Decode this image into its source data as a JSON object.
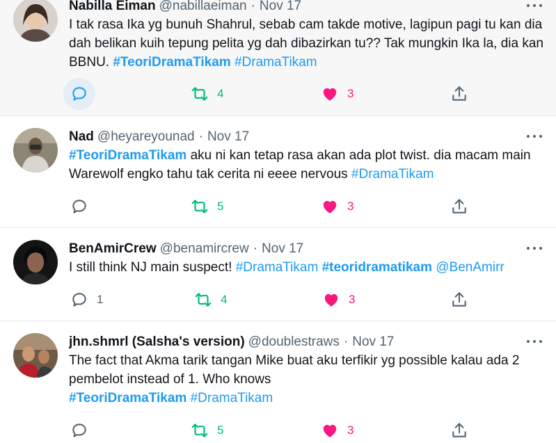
{
  "tweets": [
    {
      "name": "Nabilla Eiman",
      "handle": "@nabillaeiman",
      "sep": "·",
      "date": "Nov 17",
      "text": "I tak rasa Ika yg bunuh Shahrul, sebab cam takde motive, lagipun pagi tu kan dia dah belikan kuih tepung pelita yg dah dibazirkan tu?? Tak mungkin Ika la, dia kan BBNU. ",
      "tags": [
        "#TeoriDramaTikam",
        " ",
        "#DramaTikam"
      ],
      "replies": "",
      "retweets": "4",
      "likes": "3"
    },
    {
      "name": "Nad",
      "handle": "@heyareyounad",
      "sep": "·",
      "date": "Nov 17",
      "tag_start": "#TeoriDramaTikam",
      "text": " aku ni kan tetap rasa akan ada plot twist. dia macam main Warewolf engko tahu tak cerita ni eeee nervous ",
      "tag_end": "#DramaTikam",
      "replies": "",
      "retweets": "5",
      "likes": "3"
    },
    {
      "name": "BenAmirCrew",
      "handle": "@benamircrew",
      "sep": "·",
      "date": "Nov 17",
      "text": "I still think NJ main suspect! ",
      "tag1": "#DramaTikam",
      "tag2": "#teoridramatikam",
      "mention": "@BenAmirr",
      "replies": "1",
      "retweets": "4",
      "likes": "3"
    },
    {
      "name": "jhn.shmrl (Salsha's version)",
      "handle": "@doublestraws",
      "sep": "·",
      "date": "Nov 17",
      "text": "The fact that Akma tarik tangan Mike buat aku terfikir yg possible kalau ada 2 pembelot instead of 1. Who knows",
      "tag1": "#TeoriDramaTikam",
      "tag2": "#DramaTikam",
      "replies": "",
      "retweets": "5",
      "likes": "3"
    }
  ],
  "icons": {
    "reply": "reply-icon",
    "retweet": "retweet-icon",
    "like": "heart-icon",
    "share": "share-icon",
    "more": "more-icon"
  },
  "colors": {
    "link": "#1d9bf0",
    "retweet": "#00ba7c",
    "like": "#f91880",
    "muted": "#536471",
    "hover_bg": "#f7f7f7"
  }
}
